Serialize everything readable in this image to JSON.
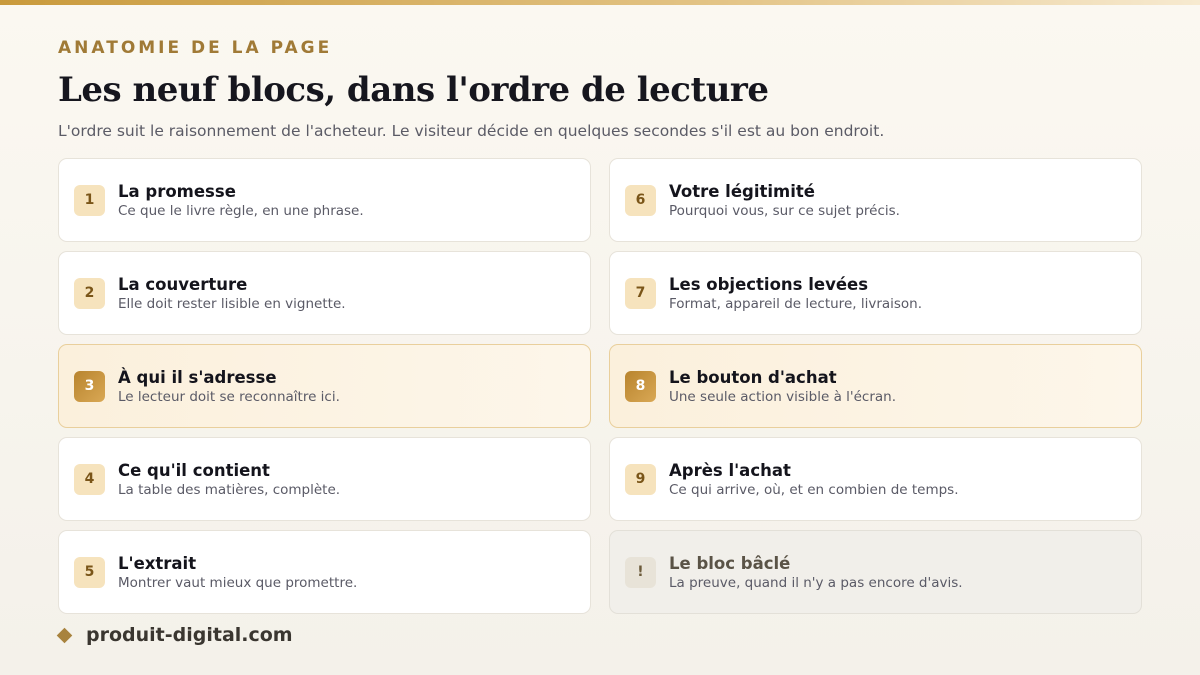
{
  "header": {
    "eyebrow": "ANATOMIE DE LA PAGE",
    "title": "Les neuf blocs, dans l'ordre de lecture",
    "subtitle": "L'ordre suit le raisonnement de l'acheteur. Le visiteur décide en quelques secondes s'il est au bon endroit."
  },
  "blocks": [
    {
      "num": "1",
      "title": "La promesse",
      "desc": "Ce que le livre règle, en une phrase."
    },
    {
      "num": "6",
      "title": "Votre légitimité",
      "desc": "Pourquoi vous, sur ce sujet précis."
    },
    {
      "num": "2",
      "title": "La couverture",
      "desc": "Elle doit rester lisible en vignette."
    },
    {
      "num": "7",
      "title": "Les objections levées",
      "desc": "Format, appareil de lecture, livraison."
    },
    {
      "num": "3",
      "title": "À qui il s'adresse",
      "desc": "Le lecteur doit se reconnaître ici."
    },
    {
      "num": "8",
      "title": "Le bouton d'achat",
      "desc": "Une seule action visible à l'écran."
    },
    {
      "num": "4",
      "title": "Ce qu'il contient",
      "desc": "La table des matières, complète."
    },
    {
      "num": "9",
      "title": "Après l'achat",
      "desc": "Ce qui arrive, où, et en combien de temps."
    },
    {
      "num": "5",
      "title": "L'extrait",
      "desc": "Montrer vaut mieux que promettre."
    },
    {
      "num": "!",
      "title": "Le bloc bâclé",
      "desc": "La preuve, quand il n'y a pas encore d'avis."
    }
  ],
  "footer": {
    "brand": "produit-digital.com"
  },
  "colors": {
    "accent": "#c99a3c",
    "highlight_bg": "#fbf0dc",
    "muted_bg": "#f1efea"
  }
}
